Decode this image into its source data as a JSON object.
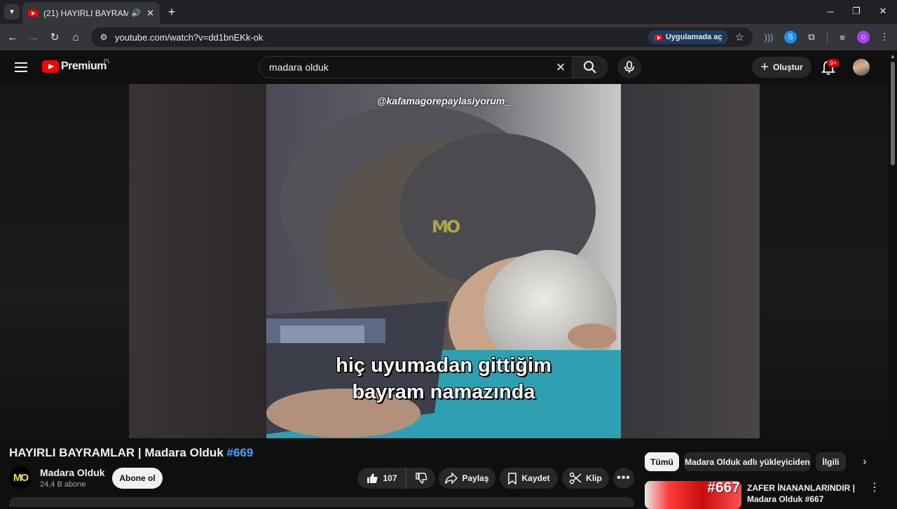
{
  "browser": {
    "tab_title": "(21) HAYIRLI BAYRAMLAR | Madara Olduk #669 - YouTube",
    "url": "youtube.com/watch?v=dd1bnEKk-ok",
    "open_in_app_label": "Uygulamada aç"
  },
  "header": {
    "logo_text": "Premium",
    "region": "PL",
    "search_value": "madara olduk",
    "create_label": "Oluştur",
    "notification_count": "9+"
  },
  "video": {
    "watermark_handle": "@kafamagorepaylasiyorum_",
    "overlay_logo": "MO",
    "caption_line1": "hiç uyumadan gittiğim",
    "caption_line2": "bayram namazında",
    "title": "HAYIRLI BAYRAMLAR | Madara Olduk",
    "title_tag": "#669",
    "channel_name": "Madara Olduk",
    "channel_avatar_text": "MO",
    "subscribers": "24,4 B abone",
    "subscribe_label": "Abone ol",
    "likes": "107",
    "share_label": "Paylaş",
    "save_label": "Kaydet",
    "clip_label": "Klip"
  },
  "sidebar": {
    "chips": [
      "Tümü",
      "Madara Olduk adlı yükleyiciden",
      "İlgili"
    ],
    "recommendations": [
      {
        "thumb_text": "#667",
        "title": "ZAFER İNANANLARINDIR | Madara Olduk #667"
      }
    ]
  },
  "colors": {
    "background": "#0f0f0f",
    "accent_red": "#ff0000",
    "link_blue": "#3ea6ff"
  }
}
